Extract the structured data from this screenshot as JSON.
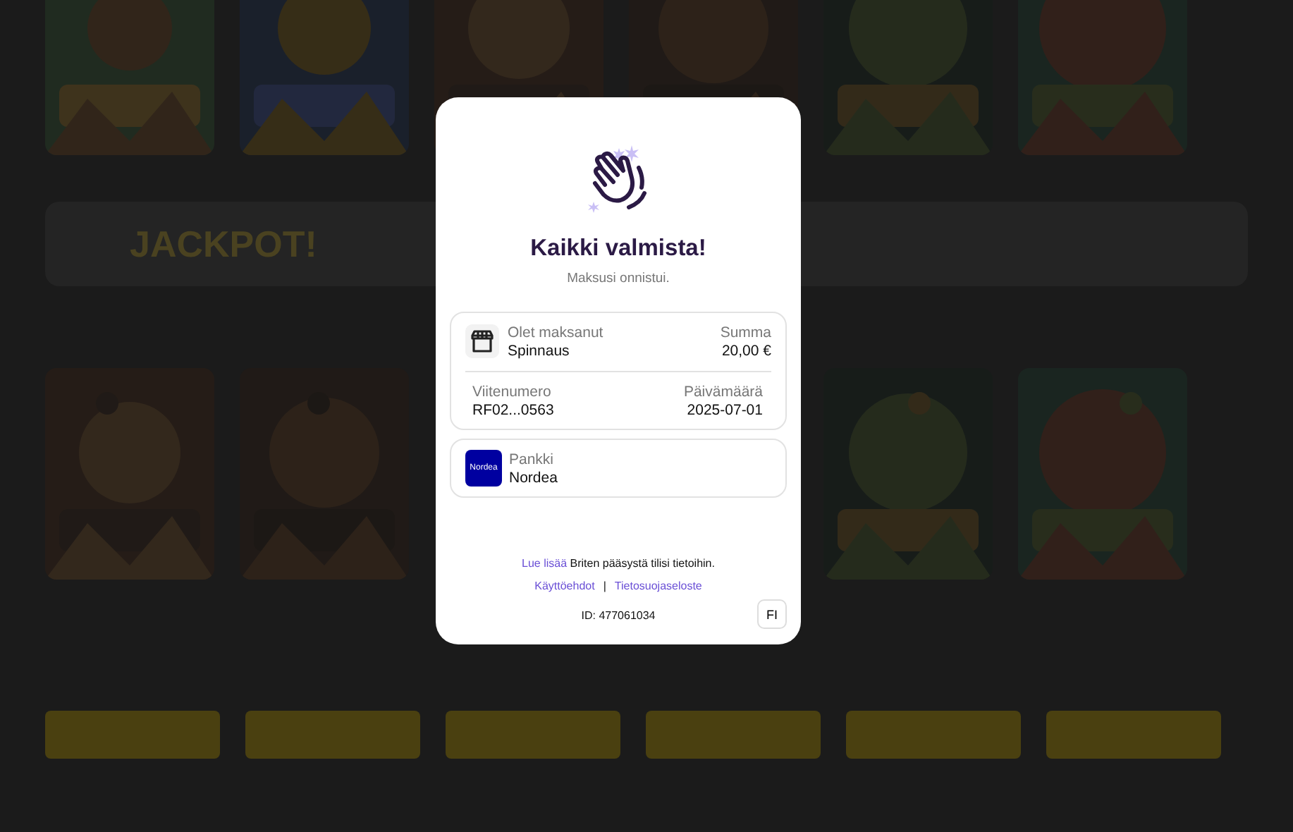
{
  "background": {
    "banner": {
      "title": "JACKPOT!"
    },
    "providers": [
      {
        "kind": "logo"
      },
      {
        "kind": "logo"
      },
      {
        "kind": "logo"
      },
      {
        "kind": "logo"
      },
      {
        "kind": "logo"
      },
      {
        "kind": "logo"
      }
    ]
  },
  "modal": {
    "title": "Kaikki valmista!",
    "subtitle": "Maksusi onnistui.",
    "payment": {
      "payee_label": "Olet maksanut",
      "payee": "Spinnaus",
      "amount_label": "Summa",
      "amount": "20,00 €",
      "reference_label": "Viitenumero",
      "reference": "RF02...0563",
      "date_label": "Päivämäärä",
      "date": "2025-07-01"
    },
    "bank": {
      "label": "Pankki",
      "name": "Nordea",
      "logo_text": "Nordea"
    },
    "info": {
      "link": "Lue lisää",
      "text": "Briten pääsystä tilisi tietoihin."
    },
    "links": [
      {
        "label": "Käyttöehdot"
      },
      {
        "label": "Tietosuojaseloste"
      }
    ],
    "separator": "|",
    "id": "ID: 477061034",
    "language": "FI"
  }
}
